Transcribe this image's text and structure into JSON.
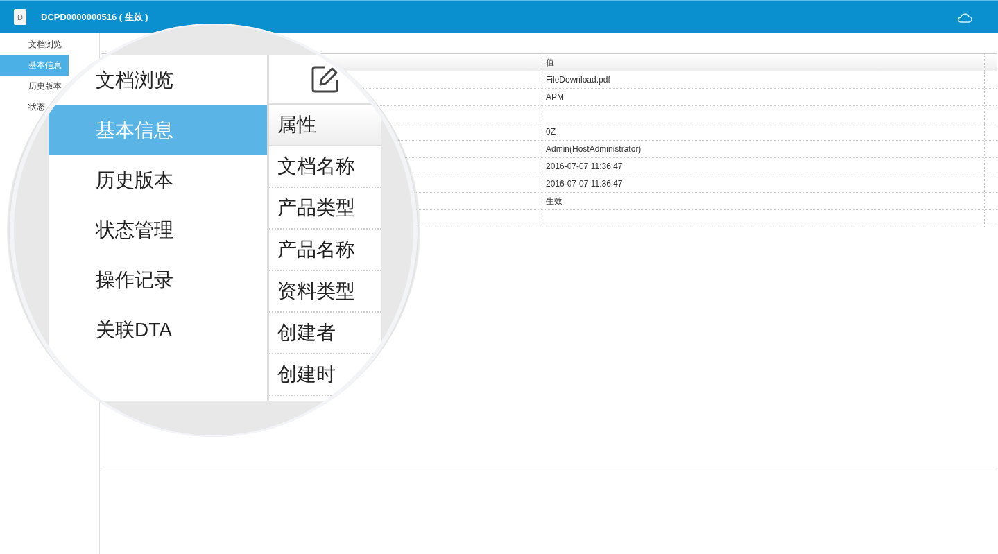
{
  "header": {
    "icon_letter": "D",
    "title": "DCPD0000000516 ( 生效 )"
  },
  "sidebar": {
    "items": [
      {
        "label": "文档浏览",
        "selected": false
      },
      {
        "label": "基本信息",
        "selected": true
      },
      {
        "label": "历史版本",
        "selected": false
      },
      {
        "label": "状态",
        "selected": false
      }
    ]
  },
  "table": {
    "value_header": "值",
    "rows": [
      "FileDownload.pdf",
      "APM",
      "",
      "0Z",
      "Admin(HostAdministrator)",
      "2016-07-07 11:36:47",
      "2016-07-07 11:36:47",
      "生效",
      ""
    ]
  },
  "magnifier": {
    "sidebar_items": [
      {
        "label": "文档浏览",
        "selected": false
      },
      {
        "label": "基本信息",
        "selected": true
      },
      {
        "label": "历史版本",
        "selected": false
      },
      {
        "label": "状态管理",
        "selected": false
      },
      {
        "label": "操作记录",
        "selected": false
      },
      {
        "label": "关联DTA",
        "selected": false
      }
    ],
    "attribute_header": "属性",
    "attributes": [
      "文档名称",
      "产品类型",
      "产品名称",
      "资料类型",
      "创建者",
      "创建时"
    ]
  }
}
